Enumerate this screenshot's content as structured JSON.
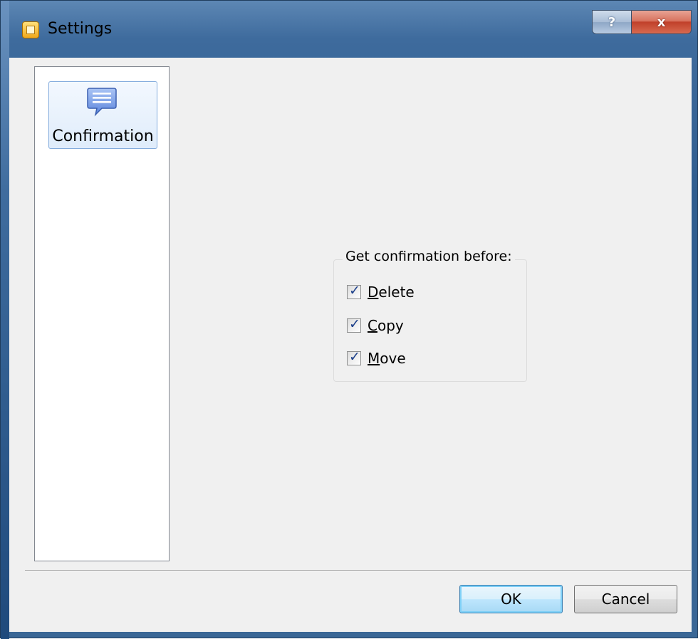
{
  "window": {
    "title": "Settings",
    "help_label": "?",
    "close_label": "x"
  },
  "nav": {
    "items": [
      {
        "label": "Confirmation",
        "icon": "speech-bubble-icon",
        "selected": true
      }
    ]
  },
  "confirmation": {
    "group_label": "Get confirmation before:",
    "options": [
      {
        "label_access": "D",
        "label_rest": "elete",
        "checked": true
      },
      {
        "label_access": "C",
        "label_rest": "opy",
        "checked": true
      },
      {
        "label_access": "M",
        "label_rest": "ove",
        "checked": true
      }
    ]
  },
  "buttons": {
    "ok_label": "OK",
    "cancel_label": "Cancel"
  },
  "colors": {
    "frame": "#3e6b9d",
    "client_bg": "#f0f0f0",
    "selection_border": "#84acdd",
    "default_button_glow": "#7fd0f7"
  }
}
